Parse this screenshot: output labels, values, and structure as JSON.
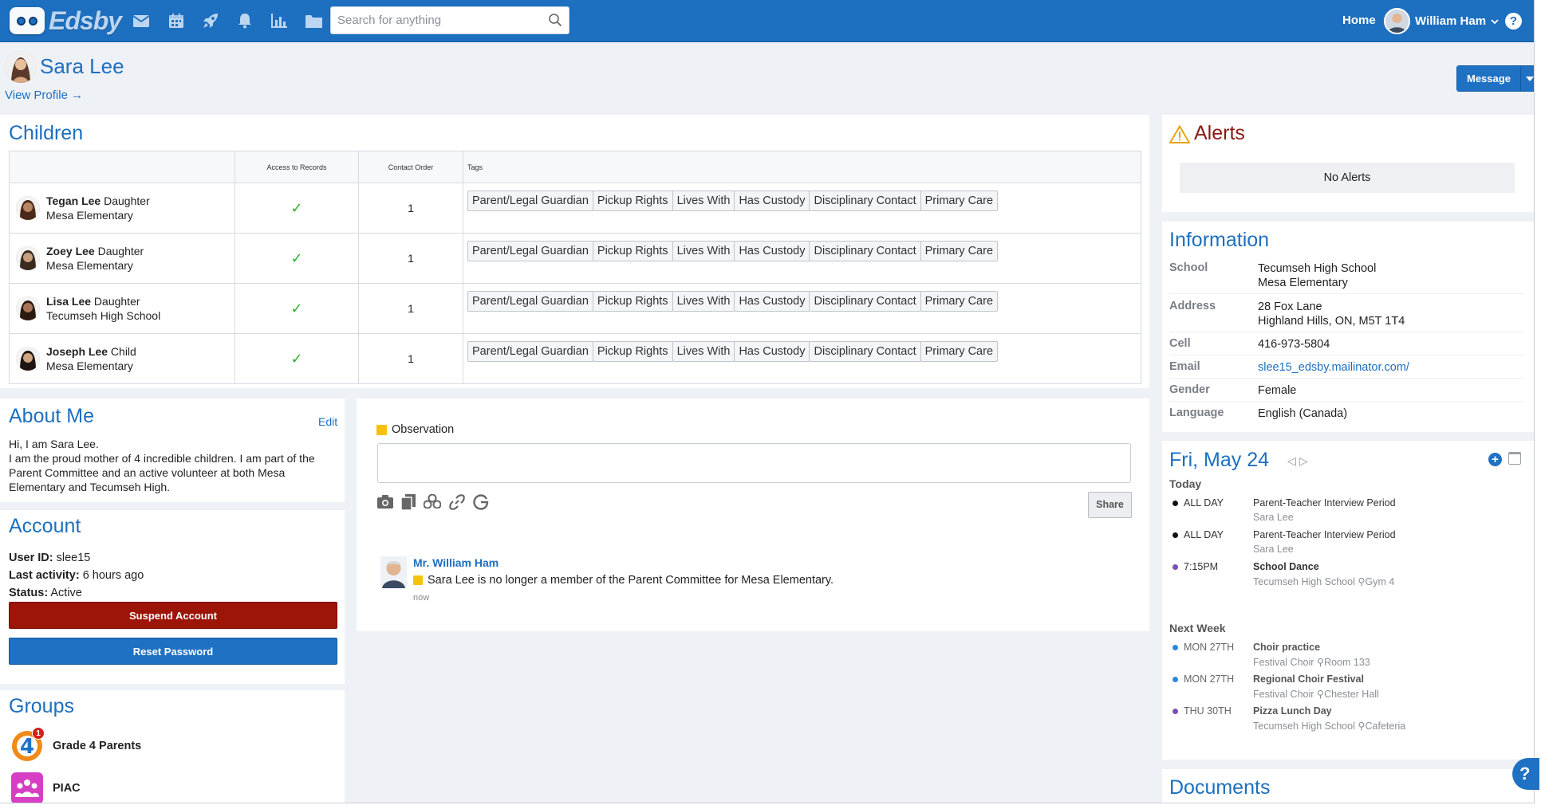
{
  "app": {
    "name": "Edsby",
    "search_placeholder": "Search for anything",
    "home_label": "Home",
    "user_name": "William Ham",
    "help_label": "?"
  },
  "nav_icons": [
    "mail-icon",
    "calendar-icon",
    "rocket-icon",
    "bell-icon",
    "chart-icon",
    "folder-icon"
  ],
  "profile": {
    "name": "Sara Lee",
    "view_profile": "View Profile →",
    "message_button": "Message"
  },
  "children": {
    "title": "Children",
    "columns": [
      "",
      "Access to Records",
      "Contact Order",
      "Tags"
    ],
    "rows": [
      {
        "name": "Tegan Lee",
        "relation": "Daughter",
        "school": "Mesa Elementary",
        "access": "✓",
        "order": "1",
        "tags": [
          "Parent/Legal Guardian",
          "Pickup Rights",
          "Lives With",
          "Has Custody",
          "Disciplinary Contact",
          "Primary Care"
        ]
      },
      {
        "name": "Zoey Lee",
        "relation": "Daughter",
        "school": "Mesa Elementary",
        "access": "✓",
        "order": "1",
        "tags": [
          "Parent/Legal Guardian",
          "Pickup Rights",
          "Lives With",
          "Has Custody",
          "Disciplinary Contact",
          "Primary Care"
        ]
      },
      {
        "name": "Lisa Lee",
        "relation": "Daughter",
        "school": "Tecumseh High School",
        "access": "✓",
        "order": "1",
        "tags": [
          "Parent/Legal Guardian",
          "Pickup Rights",
          "Lives With",
          "Has Custody",
          "Disciplinary Contact",
          "Primary Care"
        ]
      },
      {
        "name": "Joseph Lee",
        "relation": "Child",
        "school": "Mesa Elementary",
        "access": "✓",
        "order": "1",
        "tags": [
          "Parent/Legal Guardian",
          "Pickup Rights",
          "Lives With",
          "Has Custody",
          "Disciplinary Contact",
          "Primary Care"
        ]
      }
    ]
  },
  "about": {
    "title": "About Me",
    "edit": "Edit",
    "line1": "Hi, I am Sara Lee.",
    "line2": "I am the proud mother of 4 incredible children. I am part of the Parent Committee and an active volunteer at both Mesa Elementary and Tecumseh High."
  },
  "account": {
    "title": "Account",
    "user_id_label": "User ID:",
    "user_id": "slee15",
    "last_activity_label": "Last activity:",
    "last_activity": "6 hours ago",
    "status_label": "Status:",
    "status": "Active",
    "suspend_button": "Suspend Account",
    "reset_button": "Reset Password"
  },
  "groups": {
    "title": "Groups",
    "items": [
      {
        "name": "Grade 4 Parents",
        "badge": "1",
        "icon_text": "4"
      },
      {
        "name": "PIAC"
      }
    ]
  },
  "feed": {
    "observation_label": "Observation",
    "share_button": "Share",
    "post": {
      "author": "Mr. William Ham",
      "text": "Sara Lee is no longer a member of the Parent Committee for Mesa Elementary.",
      "time": "now"
    }
  },
  "alerts": {
    "title": "Alerts",
    "empty": "No Alerts"
  },
  "information": {
    "title": "Information",
    "rows": [
      {
        "label": "School",
        "lines": [
          "Tecumseh High School",
          "Mesa Elementary"
        ]
      },
      {
        "label": "Address",
        "lines": [
          "28 Fox Lane",
          "Highland Hills, ON, M5T 1T4"
        ]
      },
      {
        "label": "Cell",
        "lines": [
          "416-973-5804"
        ]
      },
      {
        "label": "Email",
        "lines": [
          "slee15_edsby.mailinator.com/"
        ]
      },
      {
        "label": "Gender",
        "lines": [
          "Female"
        ]
      },
      {
        "label": "Language",
        "lines": [
          "English (Canada)"
        ]
      }
    ]
  },
  "calendar": {
    "date": "Fri, May 24",
    "today_label": "Today",
    "today": [
      {
        "when": "ALL DAY",
        "title": "Parent-Teacher Interview Period",
        "sub": "Sara Lee",
        "color": "#111111"
      },
      {
        "when": "ALL DAY",
        "title": "Parent-Teacher Interview Period",
        "sub": "Sara Lee",
        "color": "#111111"
      },
      {
        "when": "7:15PM",
        "title": "School Dance",
        "sub": "Tecumseh High School",
        "location": "Gym 4",
        "color": "#7b4fb5"
      }
    ],
    "next_week_label": "Next Week",
    "next_week": [
      {
        "when": "MON 27TH",
        "title": "Choir practice",
        "sub": "Festival Choir",
        "location": "Room 133",
        "color": "#2e86de"
      },
      {
        "when": "MON 27TH",
        "title": "Regional Choir Festival",
        "sub": "Festival Choir",
        "location": "Chester Hall",
        "color": "#2e86de"
      },
      {
        "when": "THU 30TH",
        "title": "Pizza Lunch Day",
        "sub": "Tecumseh High School",
        "location": "Cafeteria",
        "color": "#7b4fb5"
      }
    ]
  },
  "documents": {
    "title": "Documents"
  }
}
